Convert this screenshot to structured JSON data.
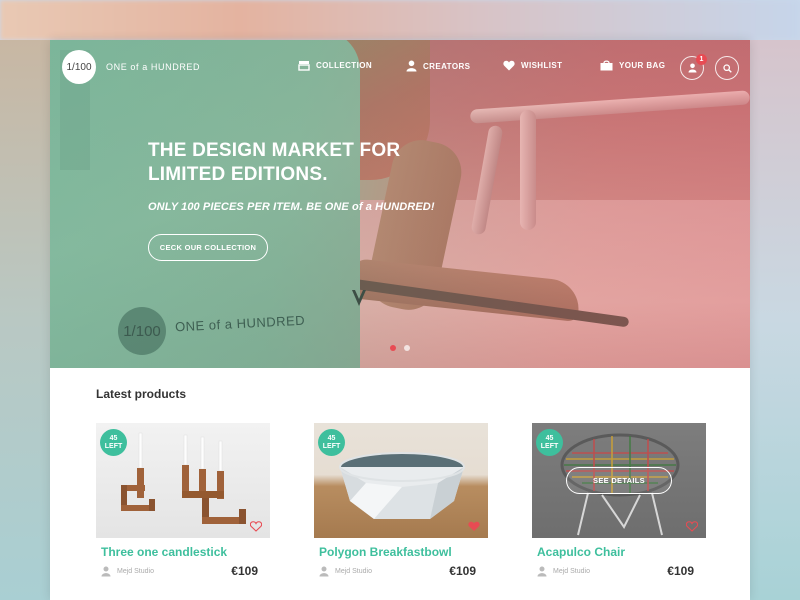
{
  "brand": {
    "logo_glyph": "1/100",
    "name": "ONE of a HUNDRED"
  },
  "nav": {
    "collection": "COLLECTION",
    "creators": "CREATORS",
    "wishlist": "WISHLIST",
    "bag": "YOUR BAG",
    "notification_count": "1",
    "icons": {
      "collection": "storefront-icon",
      "creators": "person-icon",
      "wishlist": "heart-icon",
      "bag": "shopping-bag-icon",
      "account": "user-icon",
      "search": "search-icon"
    }
  },
  "hero": {
    "headline": "THE DESIGN MARKET FOR LIMITED EDITIONS.",
    "subline": "ONLY 100 PIECES PER ITEM. BE ONE of a HUNDRED!",
    "cta": "CECK OUR COLLECTION",
    "bag_logo_glyph": "1/100",
    "bag_logo_text": "ONE of a HUNDRED",
    "slides": 2,
    "active_slide": 1
  },
  "products_section": {
    "title": "Latest products",
    "items": [
      {
        "name": "Three one candlestick",
        "creator": "Mejd Studio",
        "price": "€109",
        "left_count": "45",
        "left_label": "LEFT",
        "favorited": false
      },
      {
        "name": "Polygon Breakfastbowl",
        "creator": "Mejd Studio",
        "price": "€109",
        "left_count": "45",
        "left_label": "LEFT",
        "favorited": true
      },
      {
        "name": "Acapulco Chair",
        "creator": "Mejd Studio",
        "price": "€109",
        "left_count": "45",
        "left_label": "LEFT",
        "favorited": false,
        "overlay_button": "SEE DETAILS"
      }
    ]
  },
  "colors": {
    "accent": "#3ebf9d",
    "badge_red": "#e84b53",
    "heart_red": "#e84b53"
  }
}
